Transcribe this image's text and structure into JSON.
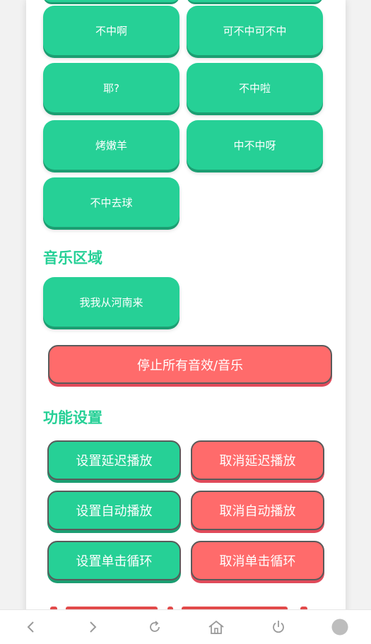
{
  "sound_buttons": [
    "不中啊",
    "可不中可不中",
    "耶?",
    "不中啦",
    "烤嫩羊",
    "中不中呀",
    "不中去球"
  ],
  "music_section": {
    "title": "音乐区域",
    "buttons": [
      "我我从河南来"
    ]
  },
  "stop_all_label": "停止所有音效/音乐",
  "settings_section": {
    "title": "功能设置",
    "set_delay": "设置延迟播放",
    "cancel_delay": "取消延迟播放",
    "set_auto": "设置自动播放",
    "cancel_auto": "取消自动播放",
    "set_loop": "设置单击循环",
    "cancel_loop": "取消单击循环"
  },
  "navbar": {
    "icons": [
      "back-icon",
      "forward-icon",
      "refresh-icon",
      "home-icon",
      "power-icon",
      "menu-dot-icon"
    ]
  },
  "colors": {
    "accent": "#26d096",
    "accent_dark": "#1c9e72",
    "danger": "#ff6b6b"
  }
}
